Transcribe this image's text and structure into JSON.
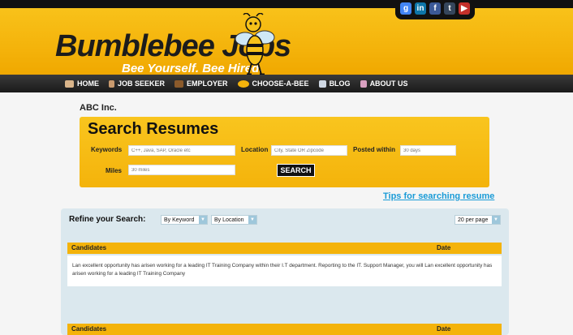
{
  "header": {
    "logo": "Bumblebee Jobs",
    "tagline": "Bee Yourself. Bee Hired."
  },
  "social": [
    {
      "name": "google",
      "glyph": "g",
      "color": "#4285f4"
    },
    {
      "name": "linkedin",
      "glyph": "in",
      "color": "#0e76a8"
    },
    {
      "name": "facebook",
      "glyph": "f",
      "color": "#3b5998"
    },
    {
      "name": "tumblr",
      "glyph": "t",
      "color": "#35465c"
    },
    {
      "name": "youtube",
      "glyph": "▶",
      "color": "#c4302b"
    }
  ],
  "nav": {
    "home": "HOME",
    "job_seeker": "JOB SEEKER",
    "employer": "EMPLOYER",
    "choose_a_bee": "CHOOSE-A-BEE",
    "blog": "BLOG",
    "about_us": "ABOUT US"
  },
  "company": "ABC  Inc.",
  "search": {
    "title": "Search Resumes",
    "keywords_label": "Keywords",
    "keywords_placeholder": "C++, Java, SAP, Oracle etc",
    "location_label": "Location",
    "location_placeholder": "City, State OR Zipcode",
    "posted_label": "Posted within",
    "posted_placeholder": "30 days",
    "miles_label": "Miles",
    "miles_placeholder": "30 miles",
    "button": "SEARCH"
  },
  "tips_link": "Tips for searching resume",
  "refine": {
    "label": "Refine your Search:",
    "by_keyword": "By Keyword",
    "by_location": "By Location",
    "per_page": "20 per page"
  },
  "table": {
    "col_candidates": "Candidates",
    "col_date": "Date",
    "row1_text": "Lan excellent opportunity has arisen working for a leading IT Training Company within their I.T department. Reporting to the IT. Support Manager, you will Lan excellent opportunity has arisen working for a leading IT Training Company"
  }
}
